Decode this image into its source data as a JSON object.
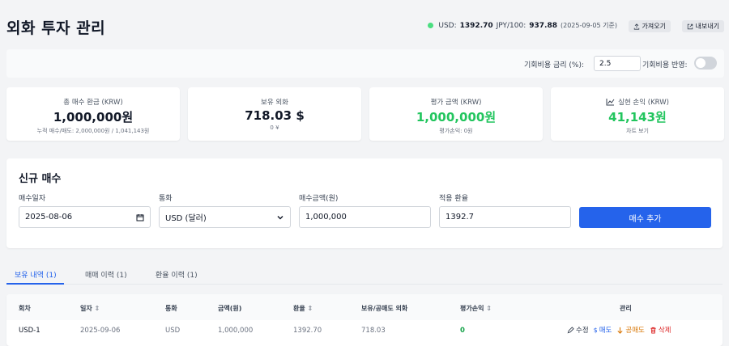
{
  "header": {
    "title": "외화 투자 관리",
    "usd_label": "USD:",
    "usd_value": "1392.70",
    "jpy_label": "JPY/100:",
    "jpy_value": "937.88",
    "rate_date": "(2025-09-05 기준)",
    "fetch_button": "가져오기",
    "export_button": "내보내기",
    "status_color": "#4ade80"
  },
  "settings": {
    "opportunity_rate_label": "기회비용 금리 (%):",
    "opportunity_rate_value": "2.5",
    "apply_label": "기회비용 반영:",
    "apply_enabled": false
  },
  "cards": [
    {
      "label": "총 매수 환금 (KRW)",
      "value": "1,000,000원",
      "sub": "누적 매수/매도: 2,000,000원 / 1,041,143원"
    },
    {
      "label": "보유 외화",
      "value": "718.03 $",
      "sub": "0 ¥"
    },
    {
      "label": "평가 금액 (KRW)",
      "value": "1,000,000원",
      "sub": "평가손익: 0원"
    },
    {
      "label": "실현 손익 (KRW)",
      "value": "41,143원",
      "sub": "차트 보기",
      "icon": "chart-icon"
    }
  ],
  "new_buy": {
    "title": "신규 매수",
    "date_label": "매수일자",
    "date_value": "2025-08-06",
    "currency_label": "통화",
    "currency_value": "USD (달러)",
    "amount_label": "매수금액(원)",
    "amount_value": "1,000,000",
    "rate_label": "적용 환율",
    "rate_value": "1392.7",
    "add_button": "매수 추가",
    "accent_color": "#2563eb"
  },
  "tabs": [
    {
      "label": "보유 내역 (1)",
      "active": true
    },
    {
      "label": "매매 이력 (1)",
      "active": false
    },
    {
      "label": "환율 이력 (1)",
      "active": false
    }
  ],
  "table": {
    "headers": [
      "회차",
      "일자",
      "통화",
      "금액(원)",
      "환율",
      "보유/공매도 외화",
      "평가손익",
      "관리"
    ],
    "sort_glyph": "⇕",
    "rows": [
      {
        "round": "USD-1",
        "date": "2025-09-06",
        "currency": "USD",
        "amount": "1,000,000",
        "rate": "1392.70",
        "holding": "718.03",
        "pnl": "0",
        "actions": {
          "edit": "수정",
          "buy": "매도",
          "short": "공매도",
          "delete": "삭제"
        }
      }
    ]
  }
}
